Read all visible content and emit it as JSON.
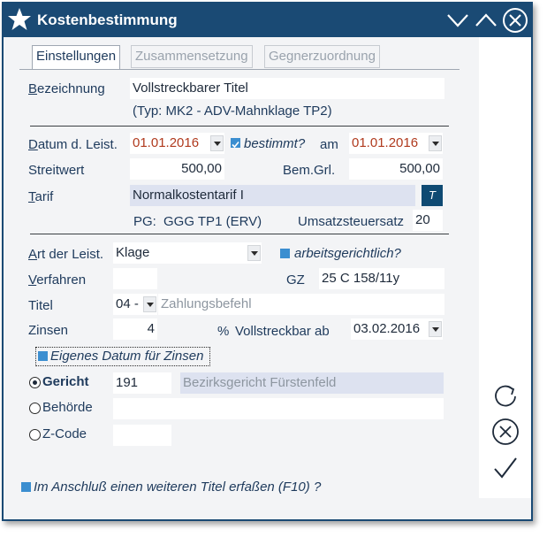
{
  "window": {
    "title": "Kostenbestimmung",
    "icons": {
      "app": "star-icon",
      "minimize": "chevron-down-icon",
      "maximize": "chevron-up-icon",
      "close": "close-circle-icon"
    }
  },
  "tabs": [
    {
      "label": "Einstellungen",
      "active": true
    },
    {
      "label": "Zusammensetzung",
      "active": false
    },
    {
      "label": "Gegnerzuordnung",
      "active": false
    }
  ],
  "form": {
    "bezeichnung_label": "Bezeichnung",
    "bezeichnung_value": "Vollstreckbarer Titel",
    "typ_text": "(Typ: MK2 - ADV-Mahnklage TP2)",
    "datum_label": "Datum d. Leist.",
    "datum_value": "01.01.2016",
    "bestimmt_label": "bestimmt?",
    "am_label": "am",
    "am_value": "01.01.2016",
    "streitwert_label": "Streitwert",
    "streitwert_value": "500,00",
    "bemgrl_label": "Bem.Grl.",
    "bemgrl_value": "500,00",
    "tarif_label": "Tarif",
    "tarif_value": "Normalkostentarif I",
    "tarif_button": "T",
    "pg_label": "PG:",
    "pg_value": "GGG TP1 (ERV)",
    "ust_label": "Umsatzsteuersatz",
    "ust_value": "20",
    "art_label": "Art der Leist.",
    "art_value": "Klage",
    "arbeitsgericht_label": "arbeitsgerichtlich?",
    "verfahren_label": "Verfahren",
    "verfahren_value": "",
    "gz_label": "GZ",
    "gz_value": "25 C 158/11y",
    "titel_label": "Titel",
    "titel_code": "04 -",
    "titel_value": "Zahlungsbefehl",
    "zinsen_label": "Zinsen",
    "zinsen_value": "4",
    "percent": "%",
    "vollstreckbar_label": "Vollstreckbar ab",
    "vollstreckbar_value": "03.02.2016",
    "eigenes_datum_label": "Eigenes Datum für Zinsen",
    "gericht_label": "Gericht",
    "gericht_code": "191",
    "gericht_name": "Bezirksgericht Fürstenfeld",
    "behoerde_label": "Behörde",
    "behoerde_value": "",
    "zcode_label": "Z-Code",
    "zcode_value": "",
    "anschluss_label": "Im Anschluß einen weiteren Titel erfaßen (F10) ?"
  },
  "side": {
    "icons": [
      "refresh-icon",
      "cancel-icon",
      "confirm-check-icon"
    ]
  },
  "colors": {
    "titlebar": "#1a4a74",
    "accent": "#3b8ed0",
    "date_red": "#b03a1e"
  }
}
